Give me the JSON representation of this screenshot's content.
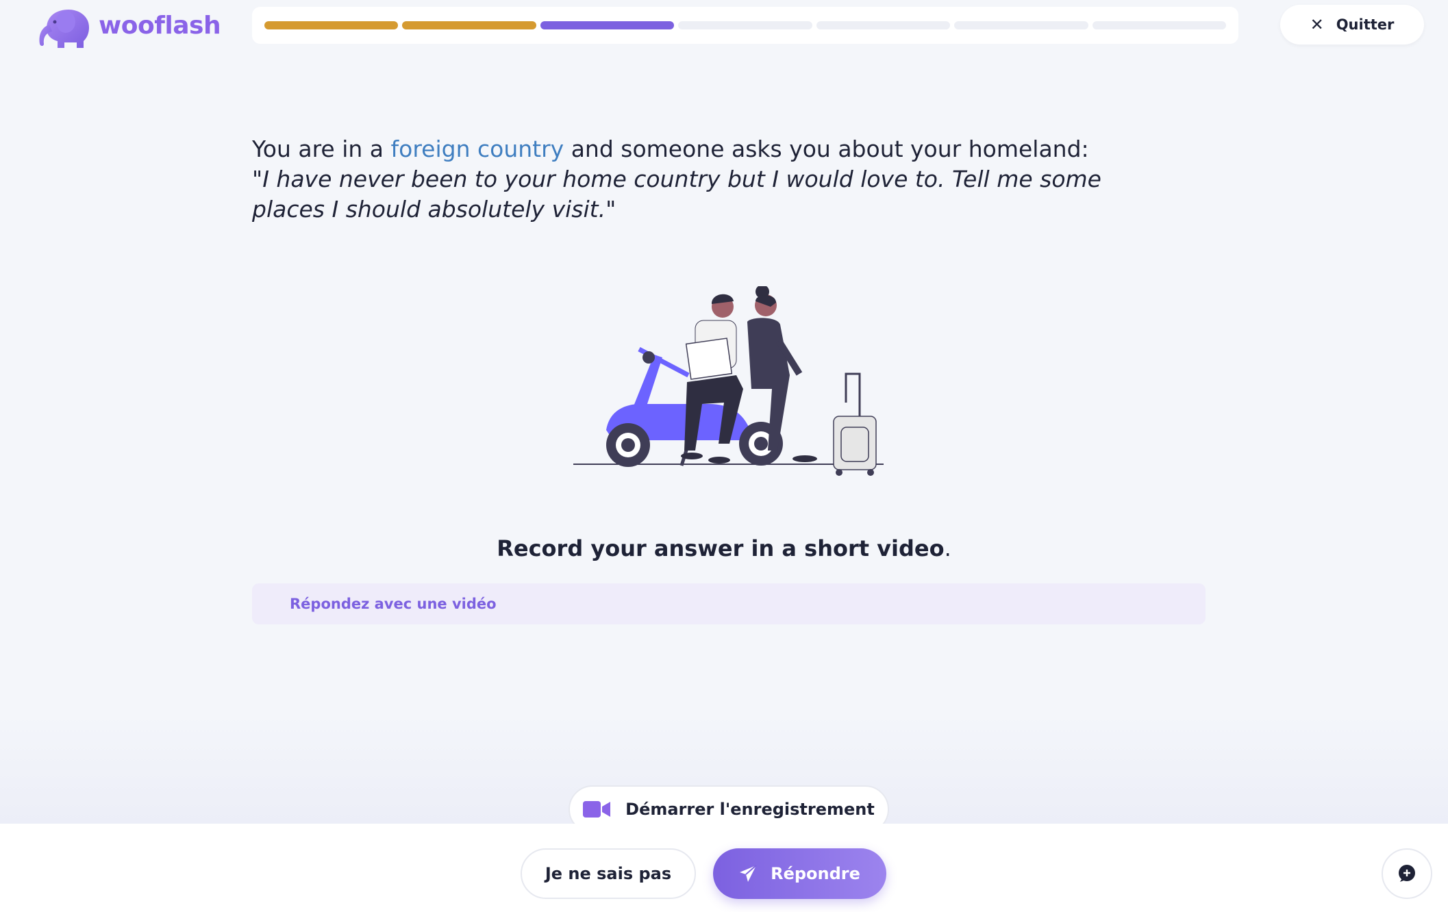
{
  "brand": {
    "name": "wooflash",
    "color": "#8a63e8"
  },
  "progress": {
    "segments": [
      "done",
      "done",
      "current",
      "todo",
      "todo",
      "todo",
      "todo"
    ],
    "colors": {
      "done": "#d59a30",
      "current": "#7c61e0",
      "todo": "#edeff5"
    }
  },
  "header": {
    "quit_label": "Quitter",
    "quit_icon": "close-icon"
  },
  "question": {
    "prefix": "You are in a ",
    "highlight": "foreign country",
    "suffix": " and someone asks you about your homeland:",
    "quote_open": "\"",
    "quote_text": "I have never been to your home country but I would love to. Tell me some places I should absolutely visit.",
    "quote_close": "\""
  },
  "instruction": {
    "text": "Record your answer in a short video",
    "punct": "."
  },
  "answer_box": {
    "label": "Répondez avec une vidéo"
  },
  "record_button": {
    "label": "Démarrer l'enregistrement",
    "icon": "video-camera-icon"
  },
  "footer": {
    "dont_know_label": "Je ne sais pas",
    "answer_label": "Répondre",
    "answer_icon": "paper-plane-icon",
    "chat_icon": "chat-plus-icon"
  },
  "colors": {
    "accent": "#7c61e0",
    "link": "#3f7ec0",
    "text": "#1e2236"
  }
}
